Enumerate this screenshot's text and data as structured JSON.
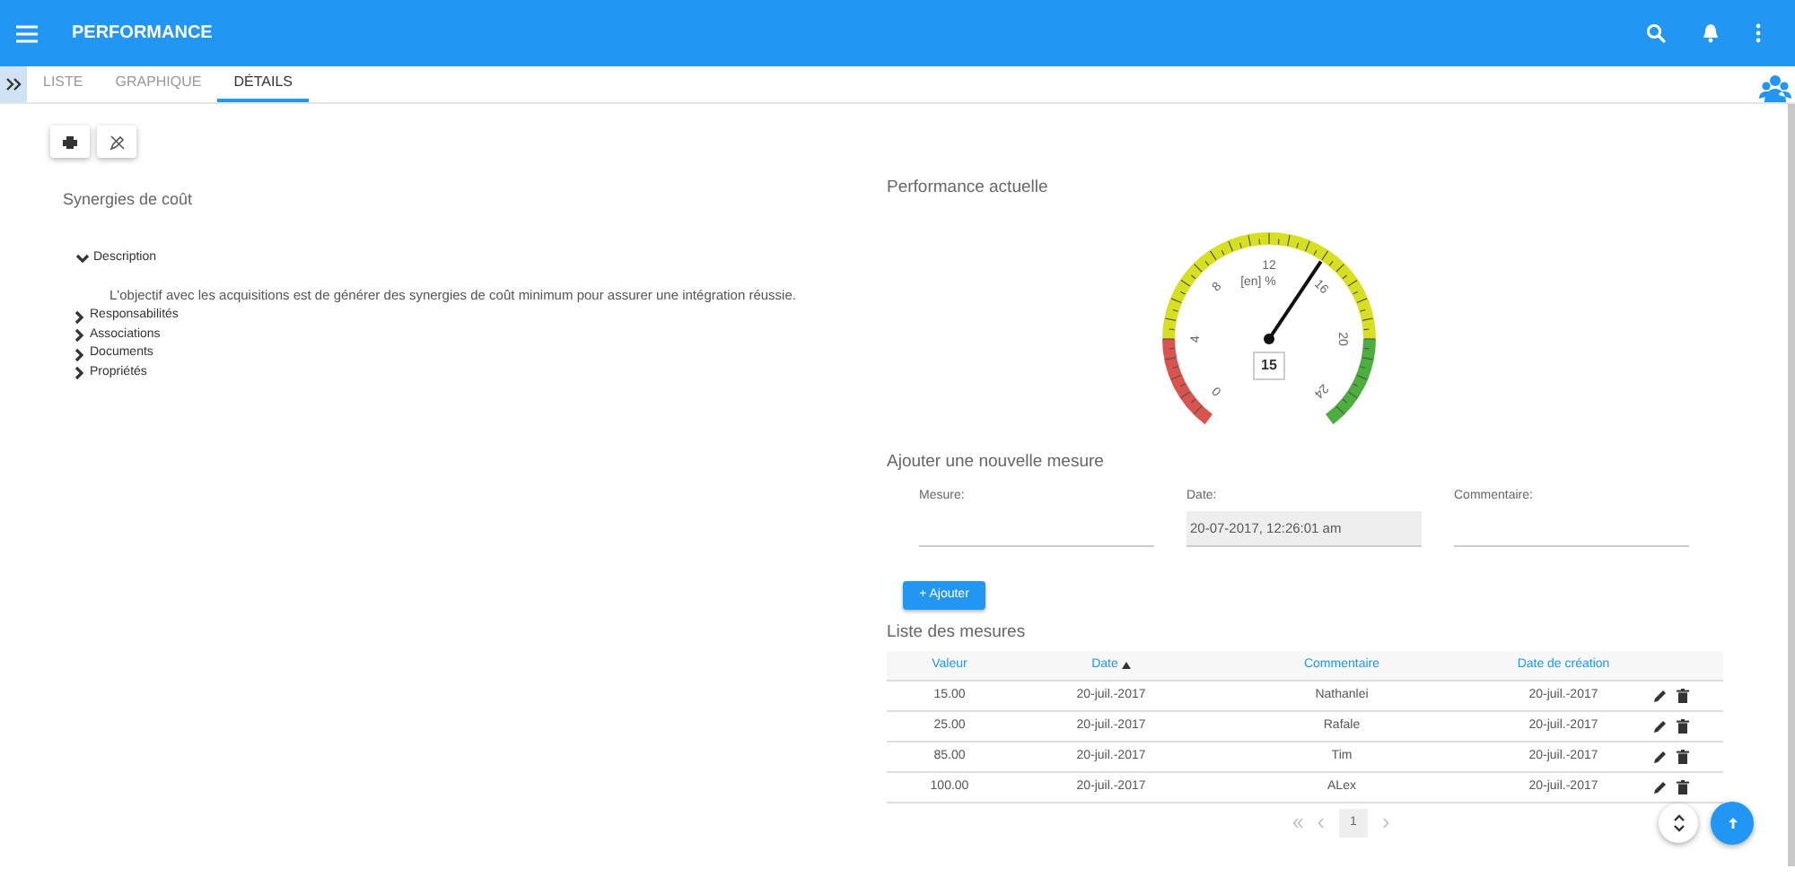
{
  "app_bar": {
    "title": "PERFORMANCE"
  },
  "tabs": [
    {
      "label": "LISTE",
      "selected": false
    },
    {
      "label": "GRAPHIQUE",
      "selected": false
    },
    {
      "label": "DÉTAILS",
      "selected": true
    }
  ],
  "item_title": "Synergies de coût",
  "sections": [
    {
      "label": "Description",
      "expanded": true,
      "text": "L'objectif avec les acquisitions est de générer des synergies de coût minimum pour assurer une intégration réussie."
    },
    {
      "label": "Responsabilités",
      "expanded": false
    },
    {
      "label": "Associations",
      "expanded": false
    },
    {
      "label": "Documents",
      "expanded": false
    },
    {
      "label": "Propriétés",
      "expanded": false
    }
  ],
  "gauge": {
    "title": "Performance actuelle",
    "unit": "[en] %",
    "value": "15",
    "level": 0.625,
    "tick_labels": [
      "0",
      "4",
      "8",
      "12",
      "16",
      "20",
      "24"
    ]
  },
  "new_measure": {
    "title": "Ajouter une nouvelle mesure",
    "fields": [
      {
        "label": "Mesure:",
        "disabled": false
      },
      {
        "label": "Date:",
        "value": "20-07-2017, 12:26:01 am",
        "disabled": true
      },
      {
        "label": "Commentaire:",
        "disabled": false
      }
    ],
    "add_button": "+ Ajouter"
  },
  "measures": {
    "title": "Liste des mesures",
    "columns": [
      {
        "label": "Valeur",
        "sorted": false
      },
      {
        "label": "Date",
        "sorted": true
      },
      {
        "label": "Commentaire",
        "sorted": false
      },
      {
        "label": "Date de création",
        "sorted": false
      }
    ],
    "rows": [
      [
        "15.00",
        "20-juil.-2017",
        "Nathanlei",
        "20-juil.-2017"
      ],
      [
        "25.00",
        "20-juil.-2017",
        "Rafale",
        "20-juil.-2017"
      ],
      [
        "85.00",
        "20-juil.-2017",
        "Tim",
        "20-juil.-2017"
      ],
      [
        "100.00",
        "20-juil.-2017",
        "ALex",
        "20-juil.-2017"
      ]
    ],
    "pagination": {
      "page": "1"
    }
  }
}
